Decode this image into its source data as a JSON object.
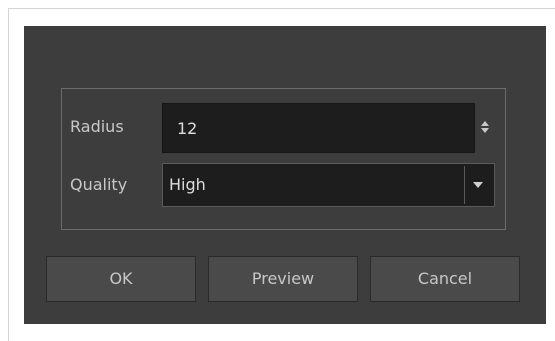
{
  "dialog": {
    "radius": {
      "label": "Radius",
      "value": "12"
    },
    "quality": {
      "label": "Quality",
      "value": "High"
    },
    "buttons": {
      "ok": "OK",
      "preview": "Preview",
      "cancel": "Cancel"
    }
  },
  "icons": {
    "spinner": "spinner-arrows-icon",
    "dropdown": "chevron-down-icon"
  },
  "colors": {
    "dialog_bg": "#3d3d3d",
    "field_bg": "#1d1d1d",
    "button_bg": "#4a4a4a",
    "text": "#c8c8c8"
  }
}
